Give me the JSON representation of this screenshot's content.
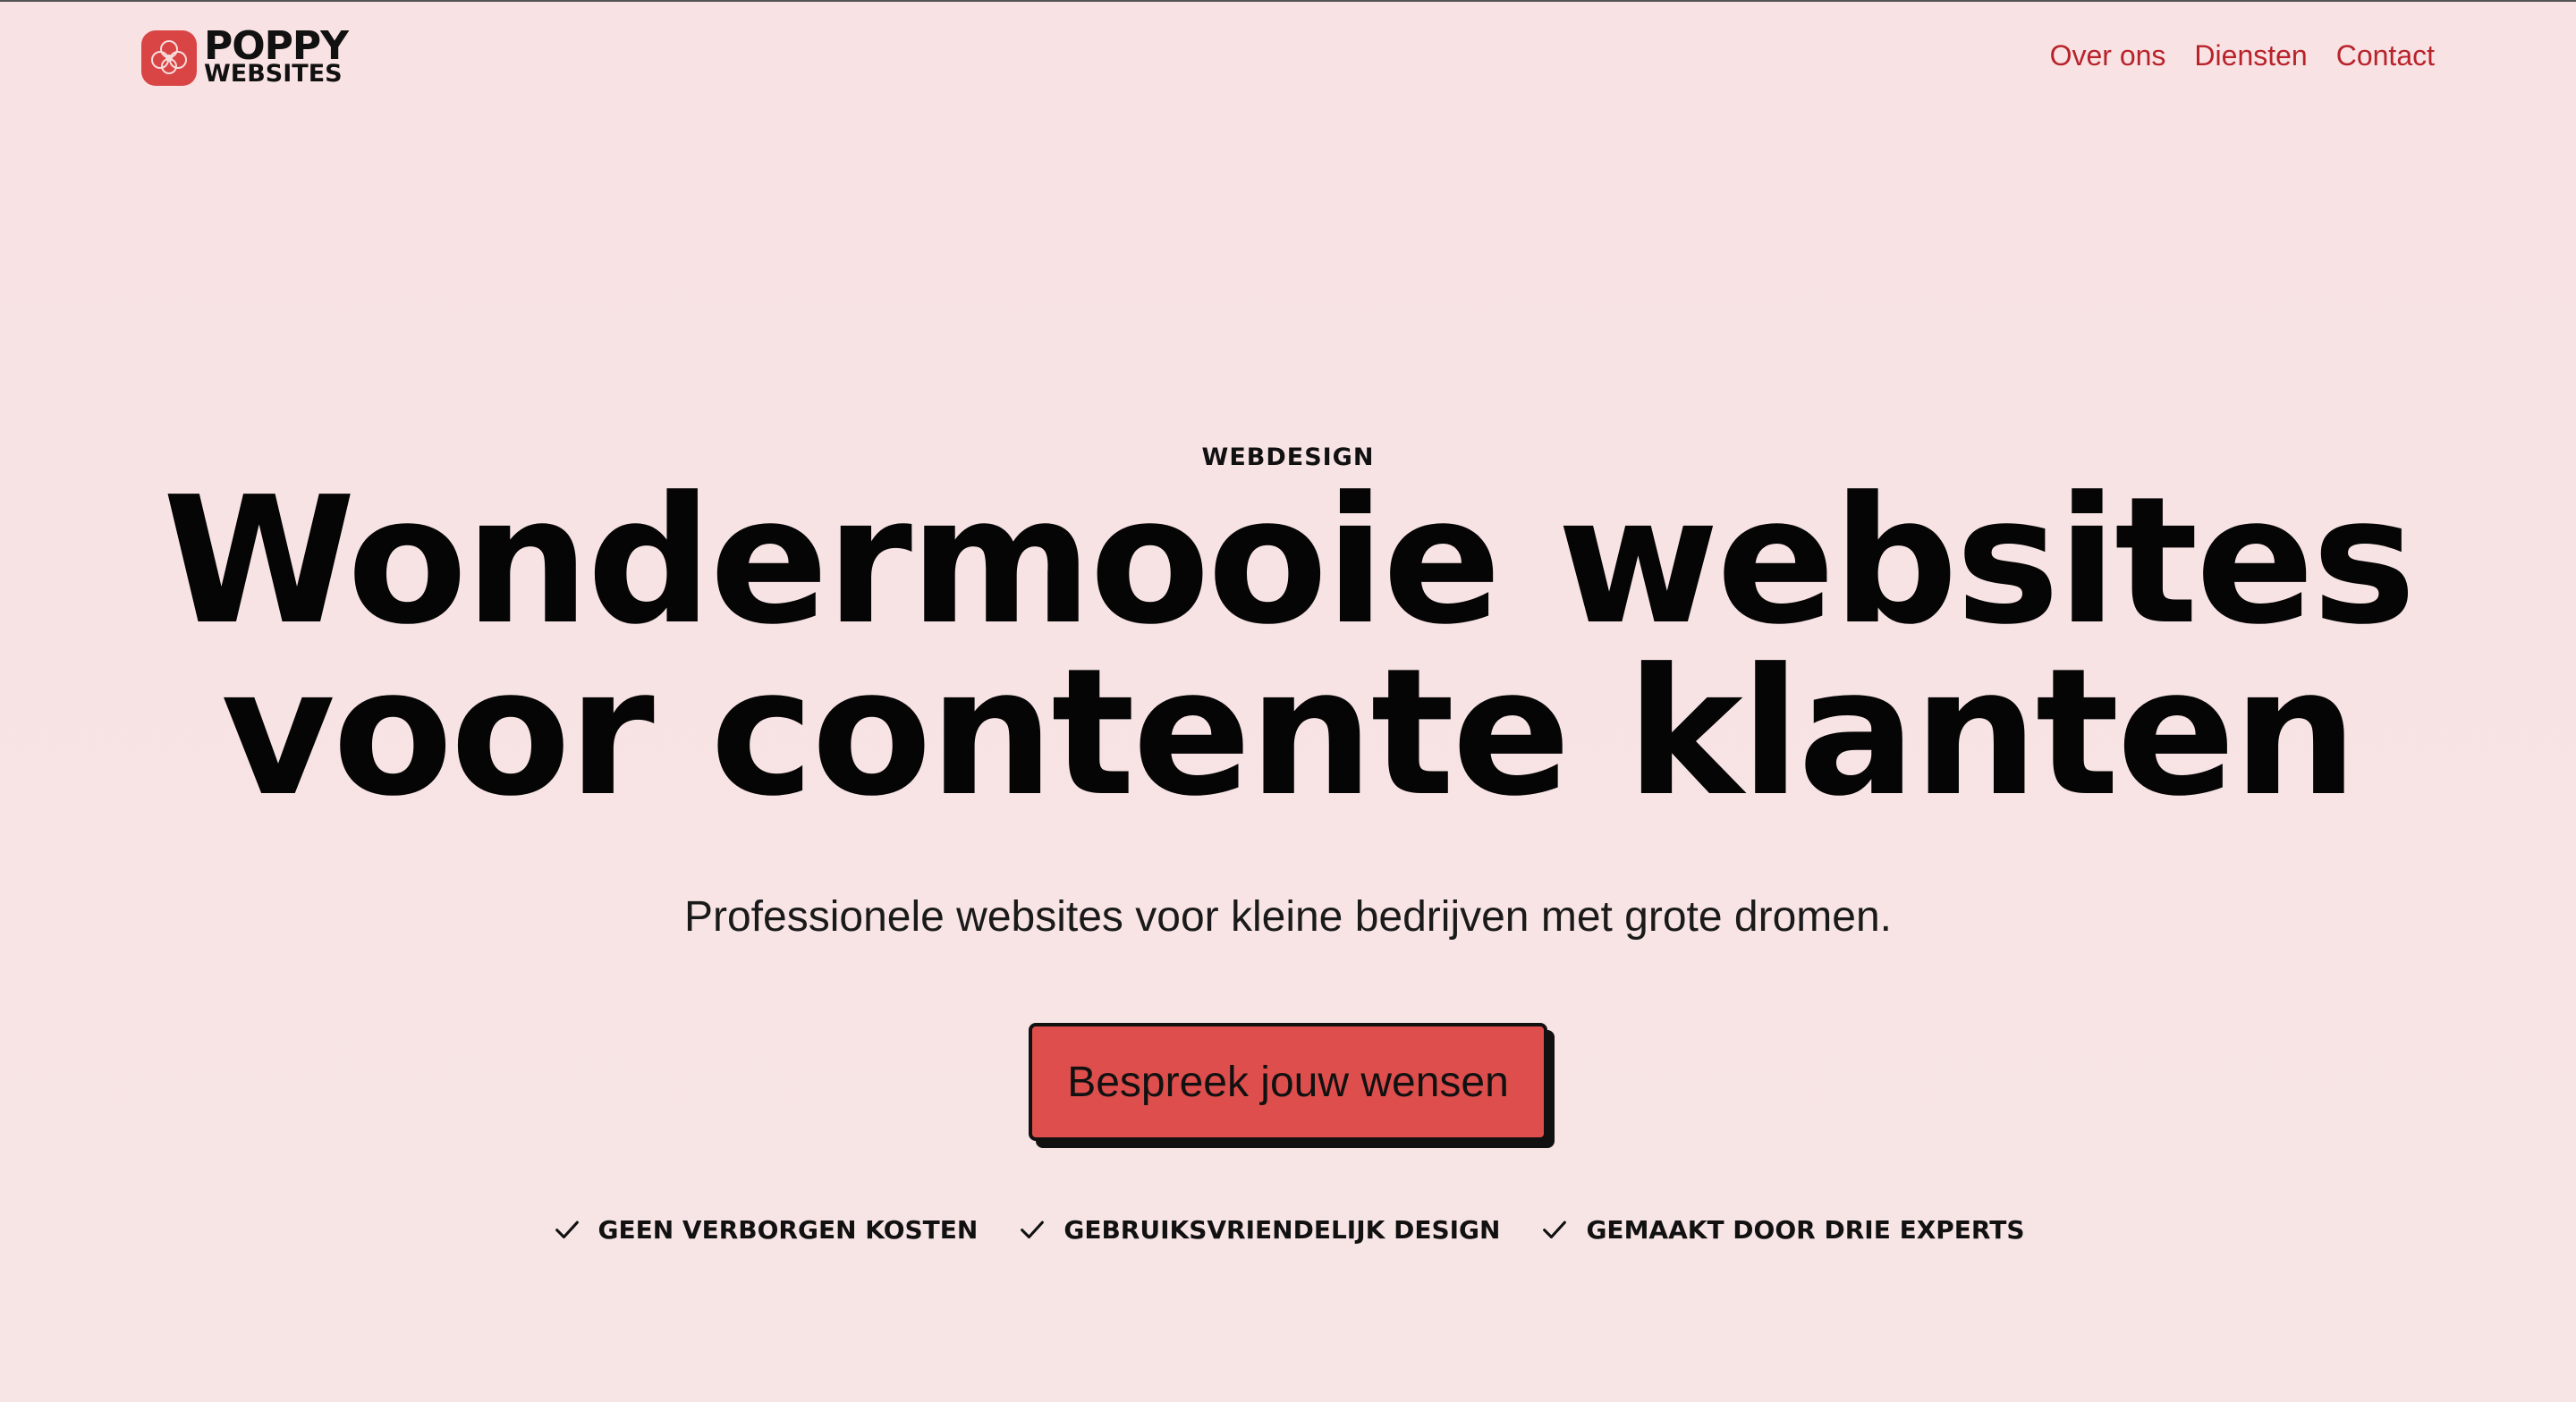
{
  "brand": {
    "name_line1": "POPPY",
    "name_line2": "WEBSITES",
    "logo_icon": "poppy-flower-icon",
    "accent_color": "#d94545"
  },
  "nav": {
    "items": [
      {
        "label": "Over ons"
      },
      {
        "label": "Diensten"
      },
      {
        "label": "Contact"
      }
    ],
    "link_color": "#b8232b"
  },
  "hero": {
    "eyebrow": "WEBDESIGN",
    "headline_line1": "Wondermooie websites",
    "headline_line2": "voor contente klanten",
    "subline": "Professionele websites voor kleine bedrijven met grote dromen.",
    "cta_label": "Bespreek jouw wensen",
    "cta_color": "#de4e4c"
  },
  "usps": [
    {
      "icon": "check-icon",
      "label": "GEEN VERBORGEN KOSTEN"
    },
    {
      "icon": "check-icon",
      "label": "GEBRUIKSVRIENDELIJK DESIGN"
    },
    {
      "icon": "check-icon",
      "label": "GEMAAKT DOOR DRIE EXPERTS"
    }
  ],
  "colors": {
    "background": "#f8e3e4",
    "text": "#111111"
  }
}
